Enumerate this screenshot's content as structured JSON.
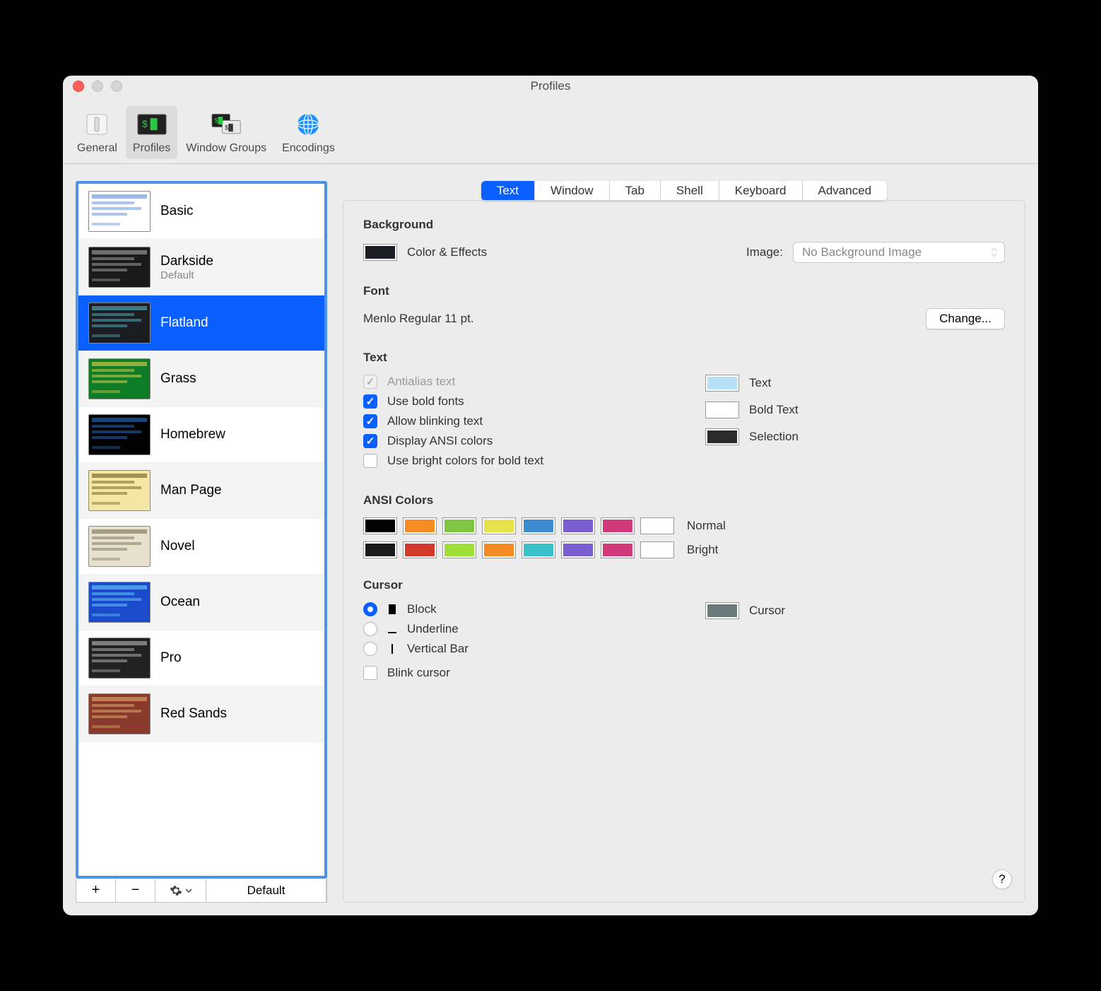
{
  "window": {
    "title": "Profiles"
  },
  "toolbar": {
    "items": [
      {
        "label": "General"
      },
      {
        "label": "Profiles"
      },
      {
        "label": "Window Groups"
      },
      {
        "label": "Encodings"
      }
    ],
    "active": 1
  },
  "sidebar": {
    "profiles": [
      {
        "name": "Basic",
        "sub": "",
        "thumb_bg": "#ffffff",
        "thumb_fg": "#5a8adf"
      },
      {
        "name": "Darkside",
        "sub": "Default",
        "thumb_bg": "#1a1a1a",
        "thumb_fg": "#aaaaaa"
      },
      {
        "name": "Flatland",
        "sub": "",
        "thumb_bg": "#1b1d22",
        "thumb_fg": "#56b6c2"
      },
      {
        "name": "Grass",
        "sub": "",
        "thumb_bg": "#0f7d28",
        "thumb_fg": "#e7d04a"
      },
      {
        "name": "Homebrew",
        "sub": "",
        "thumb_bg": "#000000",
        "thumb_fg": "#2a6fd0"
      },
      {
        "name": "Man Page",
        "sub": "",
        "thumb_bg": "#f5e6a3",
        "thumb_fg": "#6a5a1a"
      },
      {
        "name": "Novel",
        "sub": "",
        "thumb_bg": "#e7e0ce",
        "thumb_fg": "#7a6d52"
      },
      {
        "name": "Ocean",
        "sub": "",
        "thumb_bg": "#1b4acb",
        "thumb_fg": "#6ad0ff"
      },
      {
        "name": "Pro",
        "sub": "",
        "thumb_bg": "#222222",
        "thumb_fg": "#bbbbbb"
      },
      {
        "name": "Red Sands",
        "sub": "",
        "thumb_bg": "#8a3a2a",
        "thumb_fg": "#e0b070"
      }
    ],
    "selected": 2,
    "default_label": "Default"
  },
  "tabs": {
    "items": [
      "Text",
      "Window",
      "Tab",
      "Shell",
      "Keyboard",
      "Advanced"
    ],
    "active": 0
  },
  "background": {
    "heading": "Background",
    "color_label": "Color & Effects",
    "color_value": "#1b1d22",
    "image_label": "Image:",
    "image_select": "No Background Image"
  },
  "font": {
    "heading": "Font",
    "description": "Menlo Regular 11 pt.",
    "change_label": "Change..."
  },
  "text": {
    "heading": "Text",
    "options": [
      {
        "label": "Antialias text",
        "checked": true,
        "disabled": true
      },
      {
        "label": "Use bold fonts",
        "checked": true,
        "disabled": false
      },
      {
        "label": "Allow blinking text",
        "checked": true,
        "disabled": false
      },
      {
        "label": "Display ANSI colors",
        "checked": true,
        "disabled": false
      },
      {
        "label": "Use bright colors for bold text",
        "checked": false,
        "disabled": false
      }
    ],
    "color_rows": [
      {
        "label": "Text",
        "color": "#b7e0f7"
      },
      {
        "label": "Bold Text",
        "color": "#ffffff"
      },
      {
        "label": "Selection",
        "color": "#2b2b2b"
      }
    ]
  },
  "ansi": {
    "heading": "ANSI Colors",
    "normal_label": "Normal",
    "bright_label": "Bright",
    "normal": [
      "#000000",
      "#f58b22",
      "#7fc642",
      "#e6e24a",
      "#3a8bd0",
      "#7a5dcf",
      "#d13a7a",
      "#ffffff"
    ],
    "bright": [
      "#1a1a1a",
      "#d43a2a",
      "#a0de3a",
      "#f58b22",
      "#3ac0c8",
      "#7a5dcf",
      "#d13a7a",
      "#ffffff"
    ]
  },
  "cursor": {
    "heading": "Cursor",
    "options": [
      {
        "label": "Block",
        "checked": true
      },
      {
        "label": "Underline",
        "checked": false
      },
      {
        "label": "Vertical Bar",
        "checked": false
      }
    ],
    "blink_label": "Blink cursor",
    "blink_checked": false,
    "color_label": "Cursor",
    "color_value": "#6b7a7a"
  }
}
